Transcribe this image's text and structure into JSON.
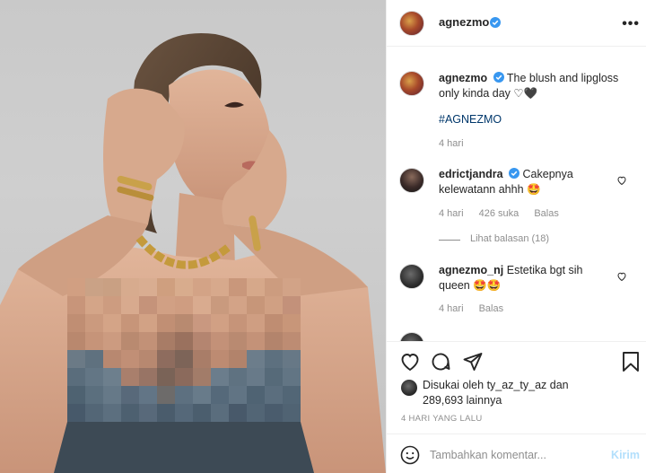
{
  "post_author": {
    "username": "agnezmo",
    "more_label": "•••"
  },
  "caption": {
    "username": "agnezmo",
    "text": "The blush and lipgloss only kinda day ♡🖤",
    "hashtag": "#AGNEZMO",
    "time": "4 hari"
  },
  "comments": [
    {
      "username": "edrictjandra",
      "verified": true,
      "text": "Cakepnya kelewatann ahhh 🤩",
      "time": "4 hari",
      "likes": "426 suka",
      "reply_label": "Balas",
      "view_replies": "Lihat balasan (18)"
    },
    {
      "username": "agnezmo_nj",
      "verified": false,
      "text": "Estetika bgt sih queen 🤩🤩",
      "time": "4 hari",
      "reply_label": "Balas"
    }
  ],
  "likes_summary": {
    "line1": "Disukai oleh ty_az_ty_az dan",
    "line2": "289,693 lainnya"
  },
  "timestamp": "4 HARI YANG LALU",
  "comment_box": {
    "placeholder": "Tambahkan komentar...",
    "post_label": "Kirim"
  },
  "colors": {
    "verified": "#3897f0",
    "link": "#00376b",
    "muted": "#8e8e8e",
    "post_disabled": "#b2dffc"
  }
}
